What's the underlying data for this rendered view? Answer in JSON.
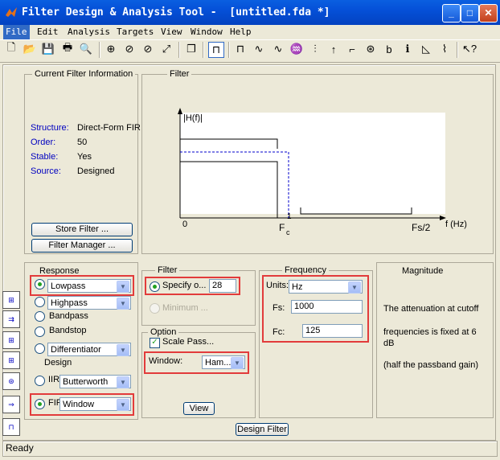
{
  "window": {
    "title": "Filter Design & Analysis Tool -  [untitled.fda *]",
    "minimize": "_",
    "maximize": "□",
    "close": "✕"
  },
  "menu": [
    "File",
    "Edit",
    "Analysis",
    "Targets",
    "View",
    "Window",
    "Help"
  ],
  "toolbar_icons": [
    "new-icon",
    "open-icon",
    "save-icon",
    "print-icon",
    "print-preview-icon",
    "zoom-in-icon",
    "zoom-x-icon",
    "zoom-y-icon",
    "full-view-icon",
    "new-figure-icon",
    "filter-spec-icon",
    "magnitude-response-icon",
    "phase-response-icon",
    "mag-phase-icon",
    "group-delay-icon",
    "impulse-response-icon",
    "step-response-icon",
    "pole-zero-icon",
    "filter-coefficients-icon",
    "filter-info-icon",
    "magnitude-estimate-icon",
    "round-off-noise-icon",
    "whats-this-icon"
  ],
  "current_filter": {
    "title": "Current Filter Information",
    "rows": [
      {
        "label": "Structure:",
        "value": "Direct-Form FIR"
      },
      {
        "label": "Order:",
        "value": "50"
      },
      {
        "label": "Stable:",
        "value": "Yes"
      },
      {
        "label": "Source:",
        "value": "Designed"
      }
    ],
    "store_button": "Store Filter ...",
    "manager_button": "Filter Manager ..."
  },
  "filter_plot": {
    "title": "Filter",
    "ylabel": "|H(f)|",
    "xlabel": "f (Hz)",
    "tick_zero": "0",
    "fc_label": "F",
    "fc_sub": "c",
    "one_label": "1",
    "fs2_label": "Fs/2"
  },
  "response": {
    "title": "Response",
    "options": [
      {
        "label": "Lowpass",
        "selected": true,
        "dropdown": true
      },
      {
        "label": "Highpass",
        "selected": false,
        "dropdown": true
      },
      {
        "label": "Bandpass",
        "selected": false,
        "dropdown": false
      },
      {
        "label": "Bandstop",
        "selected": false,
        "dropdown": false
      },
      {
        "label": "Differentiator",
        "selected": false,
        "dropdown": true
      }
    ]
  },
  "design": {
    "title": "Design",
    "iir_label": "IIR",
    "iir_value": "Butterworth",
    "fir_label": "FIR",
    "fir_value": "Window"
  },
  "filter_order": {
    "title": "Filter",
    "specify_label": "Specify o...",
    "specify_value": "28",
    "minimum_label": "Minimum ..."
  },
  "options": {
    "title": "Option",
    "scale_pass": "Scale Pass...",
    "window_label": "Window:",
    "window_value": "Ham...",
    "view_button": "View"
  },
  "frequency": {
    "title": "Frequency",
    "units_label": "Units:",
    "units_value": "Hz",
    "fs_label": "Fs:",
    "fs_value": "1000",
    "fc_label": "Fc:",
    "fc_value": "125"
  },
  "magnitude": {
    "title": "Magnitude",
    "line1": "The attenuation at cutoff",
    "line2": "frequencies is fixed at 6 dB",
    "line3": "(half the passband gain)"
  },
  "design_button": "Design Filter",
  "status": "Ready",
  "colors": {
    "highlight": "#e23b3b",
    "titlebar": "#0550d8",
    "label_blue": "#0000c0"
  }
}
